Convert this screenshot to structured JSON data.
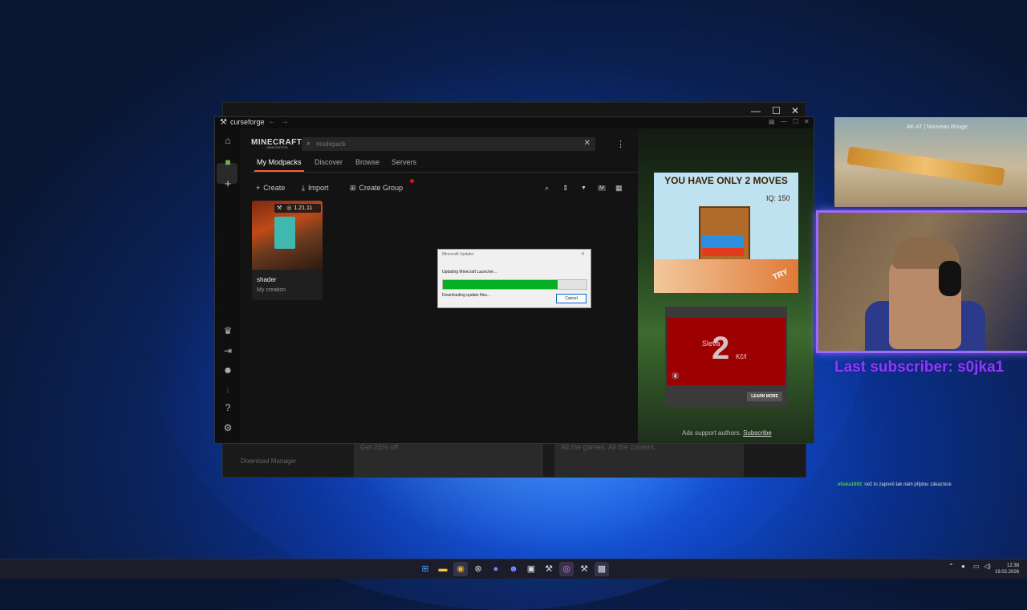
{
  "back_window": {
    "minimize_icon": "minimize-icon",
    "maximize_icon": "maximize-icon",
    "close_icon": "close-icon",
    "download_manager": "Download Manager",
    "ad1": "Get 25% off",
    "ad2": "All the games. All the content."
  },
  "app": {
    "title": "curseforge",
    "logo_icon": "anvil-icon",
    "nav_back": "←",
    "nav_forward": "→"
  },
  "sidebar": {
    "items": [
      {
        "icon": "home-icon",
        "glyph": "⌂"
      },
      {
        "icon": "minecraft-block-icon",
        "glyph": "■"
      },
      {
        "icon": "plus-icon",
        "glyph": "+"
      },
      {
        "icon": "crown-icon",
        "glyph": "♛"
      },
      {
        "icon": "login-icon",
        "glyph": "⇥"
      },
      {
        "icon": "discord-icon",
        "glyph": "☻"
      },
      {
        "icon": "download-icon",
        "glyph": "↓"
      },
      {
        "icon": "help-icon",
        "glyph": "?"
      },
      {
        "icon": "settings-icon",
        "glyph": "⚙"
      }
    ]
  },
  "header": {
    "game_logo": "MINECRAFT",
    "game_edition": "JAVA EDITION",
    "search_placeholder": "modepack",
    "search_icon": "search-icon",
    "clear_icon": "close-icon",
    "more_icon": "kebab-menu-icon"
  },
  "tabs": [
    {
      "label": "My Modpacks",
      "active": true
    },
    {
      "label": "Discover",
      "active": false
    },
    {
      "label": "Browse",
      "active": false
    },
    {
      "label": "Servers",
      "active": false
    }
  ],
  "actions": {
    "create": "Create",
    "import": "Import",
    "create_group": "Create Group"
  },
  "tools": [
    {
      "icon": "search-icon",
      "glyph": "⌕"
    },
    {
      "icon": "sort-icon",
      "glyph": "⇕"
    },
    {
      "icon": "filter-icon",
      "glyph": "▼"
    },
    {
      "icon": "m-icon",
      "glyph": "M"
    },
    {
      "icon": "grid-view-icon",
      "glyph": "▦"
    }
  ],
  "modpack": {
    "name": "shader",
    "subtitle": "My creation",
    "version": "1.21.11"
  },
  "dialog": {
    "title": "Minecraft Updater",
    "message": "Updating Minecraft Launcher...",
    "status": "Downloading update files...",
    "cancel": "Cancel",
    "progress": 0.8
  },
  "ads": {
    "ad1_title": "YOU HAVE ONLY 2 MOVES",
    "ad1_iq": "IQ: 150",
    "ad1_try": "TRY",
    "ad2_number": "2",
    "ad2_sleva": "Sleva",
    "ad2_kc": "Kč/l",
    "ad2_button": "LEARN MORE",
    "footer_text": "Ads support authors.",
    "footer_link": "Subscribe"
  },
  "stream": {
    "game_item": "AK-47 | Nouveau Rouge",
    "subscriber": "Last subscriber: s0jka1",
    "chat_user": "eliska1892",
    "chat_message": ": než to zapneš tak nám přijdou zákaznice"
  },
  "taskbar": {
    "apps": [
      {
        "icon": "windows-start-icon",
        "glyph": "⊞"
      },
      {
        "icon": "file-explorer-icon",
        "glyph": "▬"
      },
      {
        "icon": "chrome-icon",
        "glyph": "◉"
      },
      {
        "icon": "steam-icon",
        "glyph": "⊛"
      },
      {
        "icon": "app-icon",
        "glyph": "●"
      },
      {
        "icon": "discord-icon",
        "glyph": "☻"
      },
      {
        "icon": "obs-icon",
        "glyph": "▣"
      },
      {
        "icon": "curseforge-icon",
        "glyph": "⚒"
      },
      {
        "icon": "browser-icon",
        "glyph": "◎"
      },
      {
        "icon": "curseforge-icon",
        "glyph": "⚒"
      },
      {
        "icon": "minecraft-icon",
        "glyph": "▩"
      }
    ],
    "time": "12:38",
    "date": "19.02.2026"
  }
}
